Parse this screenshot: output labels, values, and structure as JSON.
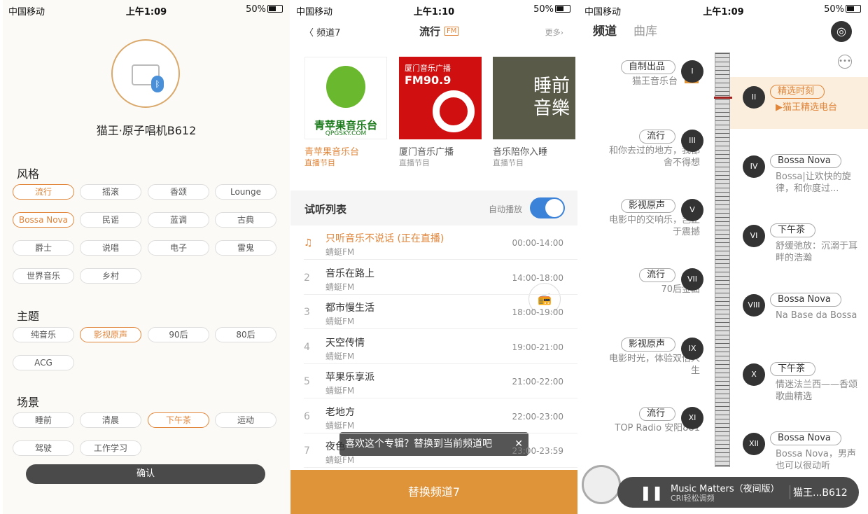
{
  "status": [
    {
      "carrier": "中国移动",
      "time": "上午1:09",
      "battery": "50%"
    },
    {
      "carrier": "中国移动",
      "time": "上午1:10",
      "battery": "50%"
    },
    {
      "carrier": "中国移动",
      "time": "上午1:09",
      "battery": "50%"
    }
  ],
  "p1": {
    "device": "猫王·原子唱机B612",
    "sections": [
      "风格",
      "主题",
      "场景"
    ],
    "style_tags": [
      "流行",
      "摇滚",
      "香颂",
      "Lounge",
      "Bossa Nova",
      "民谣",
      "蓝调",
      "古典",
      "爵士",
      "说唱",
      "电子",
      "雷鬼",
      "世界音乐",
      "乡村"
    ],
    "theme_tags": [
      "纯音乐",
      "影视原声",
      "90后",
      "80后",
      "ACG"
    ],
    "scene_tags": [
      "睡前",
      "清晨",
      "下午茶",
      "运动",
      "驾驶",
      "工作学习"
    ],
    "confirm": "确认"
  },
  "p2": {
    "back": "频道7",
    "title": "流行",
    "fm": "FM",
    "more": "更多",
    "covers": [
      {
        "name": "青苹果音乐台",
        "sub": "直播节目",
        "img_text": "青苹果音乐台",
        "img_sub": "QPGSKY.COM"
      },
      {
        "name": "厦门音乐广播",
        "sub": "直播节目",
        "img_text": "厦门音乐广播",
        "img_sub": "FM90.9"
      },
      {
        "name": "音乐陪你入睡",
        "sub": "直播节目",
        "img_text": "睡前音樂",
        "img_sub": ""
      }
    ],
    "list_title": "试听列表",
    "autoplay": "自动播放",
    "rows": [
      {
        "num": "",
        "title": "只听音乐不说话 (正在直播)",
        "src": "蜻蜓FM",
        "time": "00:00-14:00"
      },
      {
        "num": "2",
        "title": "音乐在路上",
        "src": "蜻蜓FM",
        "time": "14:00-18:00"
      },
      {
        "num": "3",
        "title": "都市慢生活",
        "src": "蜻蜓FM",
        "time": "18:00-19:00"
      },
      {
        "num": "4",
        "title": "天空传情",
        "src": "蜻蜓FM",
        "time": "19:00-21:00"
      },
      {
        "num": "5",
        "title": "苹果乐享派",
        "src": "蜻蜓FM",
        "time": "21:00-22:00"
      },
      {
        "num": "6",
        "title": "老地方",
        "src": "蜻蜓FM",
        "time": "22:00-23:00"
      },
      {
        "num": "7",
        "title": "夜色",
        "src": "蜻蜓FM",
        "time": "23:00-23:59"
      }
    ],
    "toast": "喜欢这个专辑？替换到当前频道吧",
    "replace": "替换频道7"
  },
  "p3": {
    "tab1": "频道",
    "tab2": "曲库",
    "left": [
      {
        "tag": "自制出品",
        "desc": "猫王音乐台",
        "vip": "VIP",
        "num": "I"
      },
      {
        "tag": "流行",
        "desc": "和你去过的地方，我都舍不得想",
        "num": "III"
      },
      {
        "tag": "影视原声",
        "desc": "电影中的交响乐，岂止于震撼",
        "num": "V"
      },
      {
        "tag": "流行",
        "desc": "70后金曲",
        "num": "VII"
      },
      {
        "tag": "影视原声",
        "desc": "电影时光，体验双倍人生",
        "num": "IX"
      },
      {
        "tag": "流行",
        "desc": "TOP Radio 安阳881",
        "num": "XI"
      }
    ],
    "right": [
      {
        "tag": "精选时刻",
        "desc": "▶猫王精选电台",
        "num": "II"
      },
      {
        "tag": "Bossa Nova",
        "desc": "Bossa|让欢快的旋律，和你度过...",
        "num": "IV"
      },
      {
        "tag": "下午茶",
        "desc": "舒缓弛放：沉溺于耳畔的浩瀚",
        "num": "VI"
      },
      {
        "tag": "Bossa Nova",
        "desc": "Na Base da Bossa",
        "num": "VIII"
      },
      {
        "tag": "下午茶",
        "desc": "情迷法兰西——香颂歌曲精选",
        "num": "X"
      },
      {
        "tag": "Bossa Nova",
        "desc": "Bossa Nova，男声也可以很动听",
        "num": "XII"
      }
    ],
    "player": {
      "song": "Music Matters（夜间版）",
      "station": "CRI轻松调频",
      "device": "猫王...B612"
    }
  },
  "colors": {
    "accent": "#e0853a",
    "bar": "#e0943a"
  }
}
